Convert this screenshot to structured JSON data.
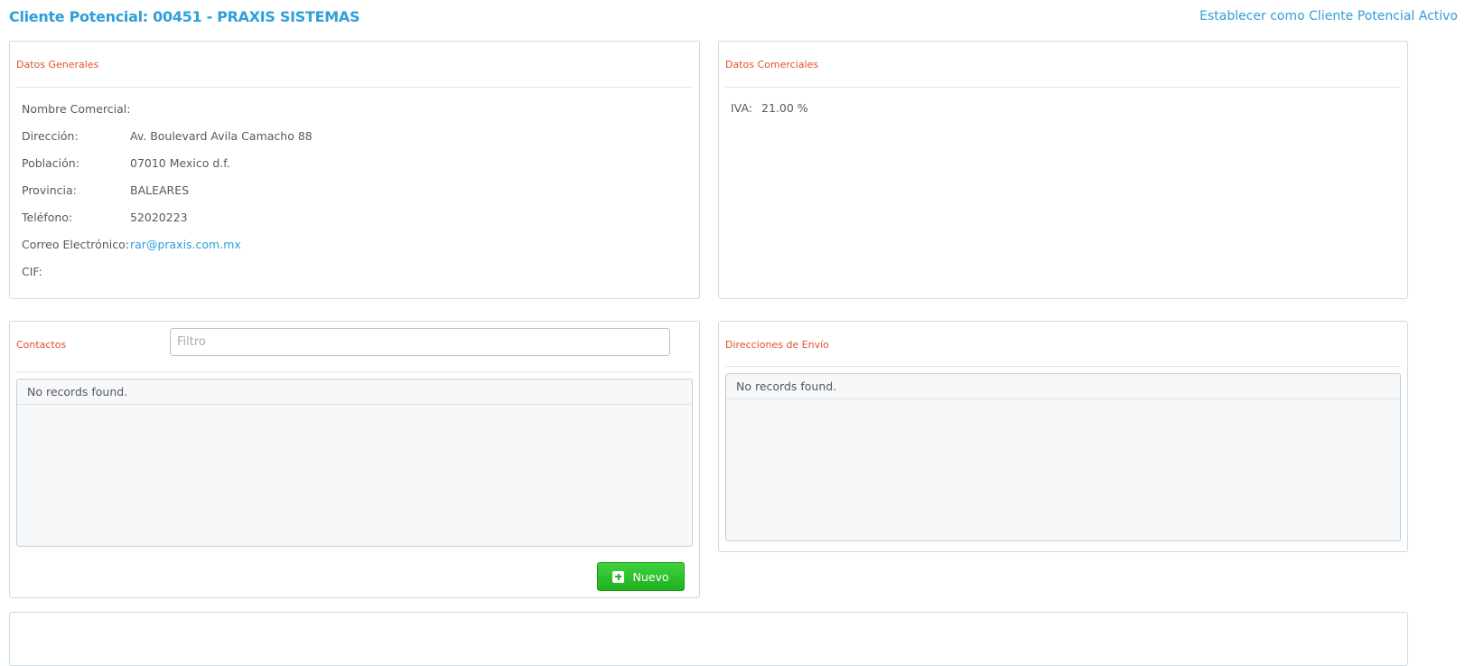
{
  "header": {
    "title": "Cliente Potencial: 00451 - PRAXIS SISTEMAS",
    "action_link": "Establecer como Cliente Potencial Activo"
  },
  "datos_generales": {
    "title": "Datos Generales",
    "fields": [
      {
        "label": "Nombre Comercial:",
        "value": ""
      },
      {
        "label": "Dirección:",
        "value": "Av. Boulevard Avila Camacho 88"
      },
      {
        "label": "Población:",
        "value": "07010 Mexico d.f."
      },
      {
        "label": "Provincia:",
        "value": "BALEARES"
      },
      {
        "label": "Teléfono:",
        "value": "52020223"
      },
      {
        "label": "Correo Electrónico:",
        "value": "rar@praxis.com.mx"
      },
      {
        "label": "CIF:",
        "value": ""
      }
    ]
  },
  "datos_comerciales": {
    "title": "Datos Comerciales",
    "iva_label": "IVA:",
    "iva_value": "21.00 %"
  },
  "contactos": {
    "title": "Contactos",
    "filter_placeholder": "Filtro",
    "empty_message": "No records found.",
    "new_button": "Nuevo"
  },
  "direcciones_envio": {
    "title": "Direcciones de Envío",
    "empty_message": "No records found."
  },
  "colors": {
    "accent": "#2e9fd8",
    "section_title": "#e0522a",
    "button_green": "#2cbf2c"
  }
}
